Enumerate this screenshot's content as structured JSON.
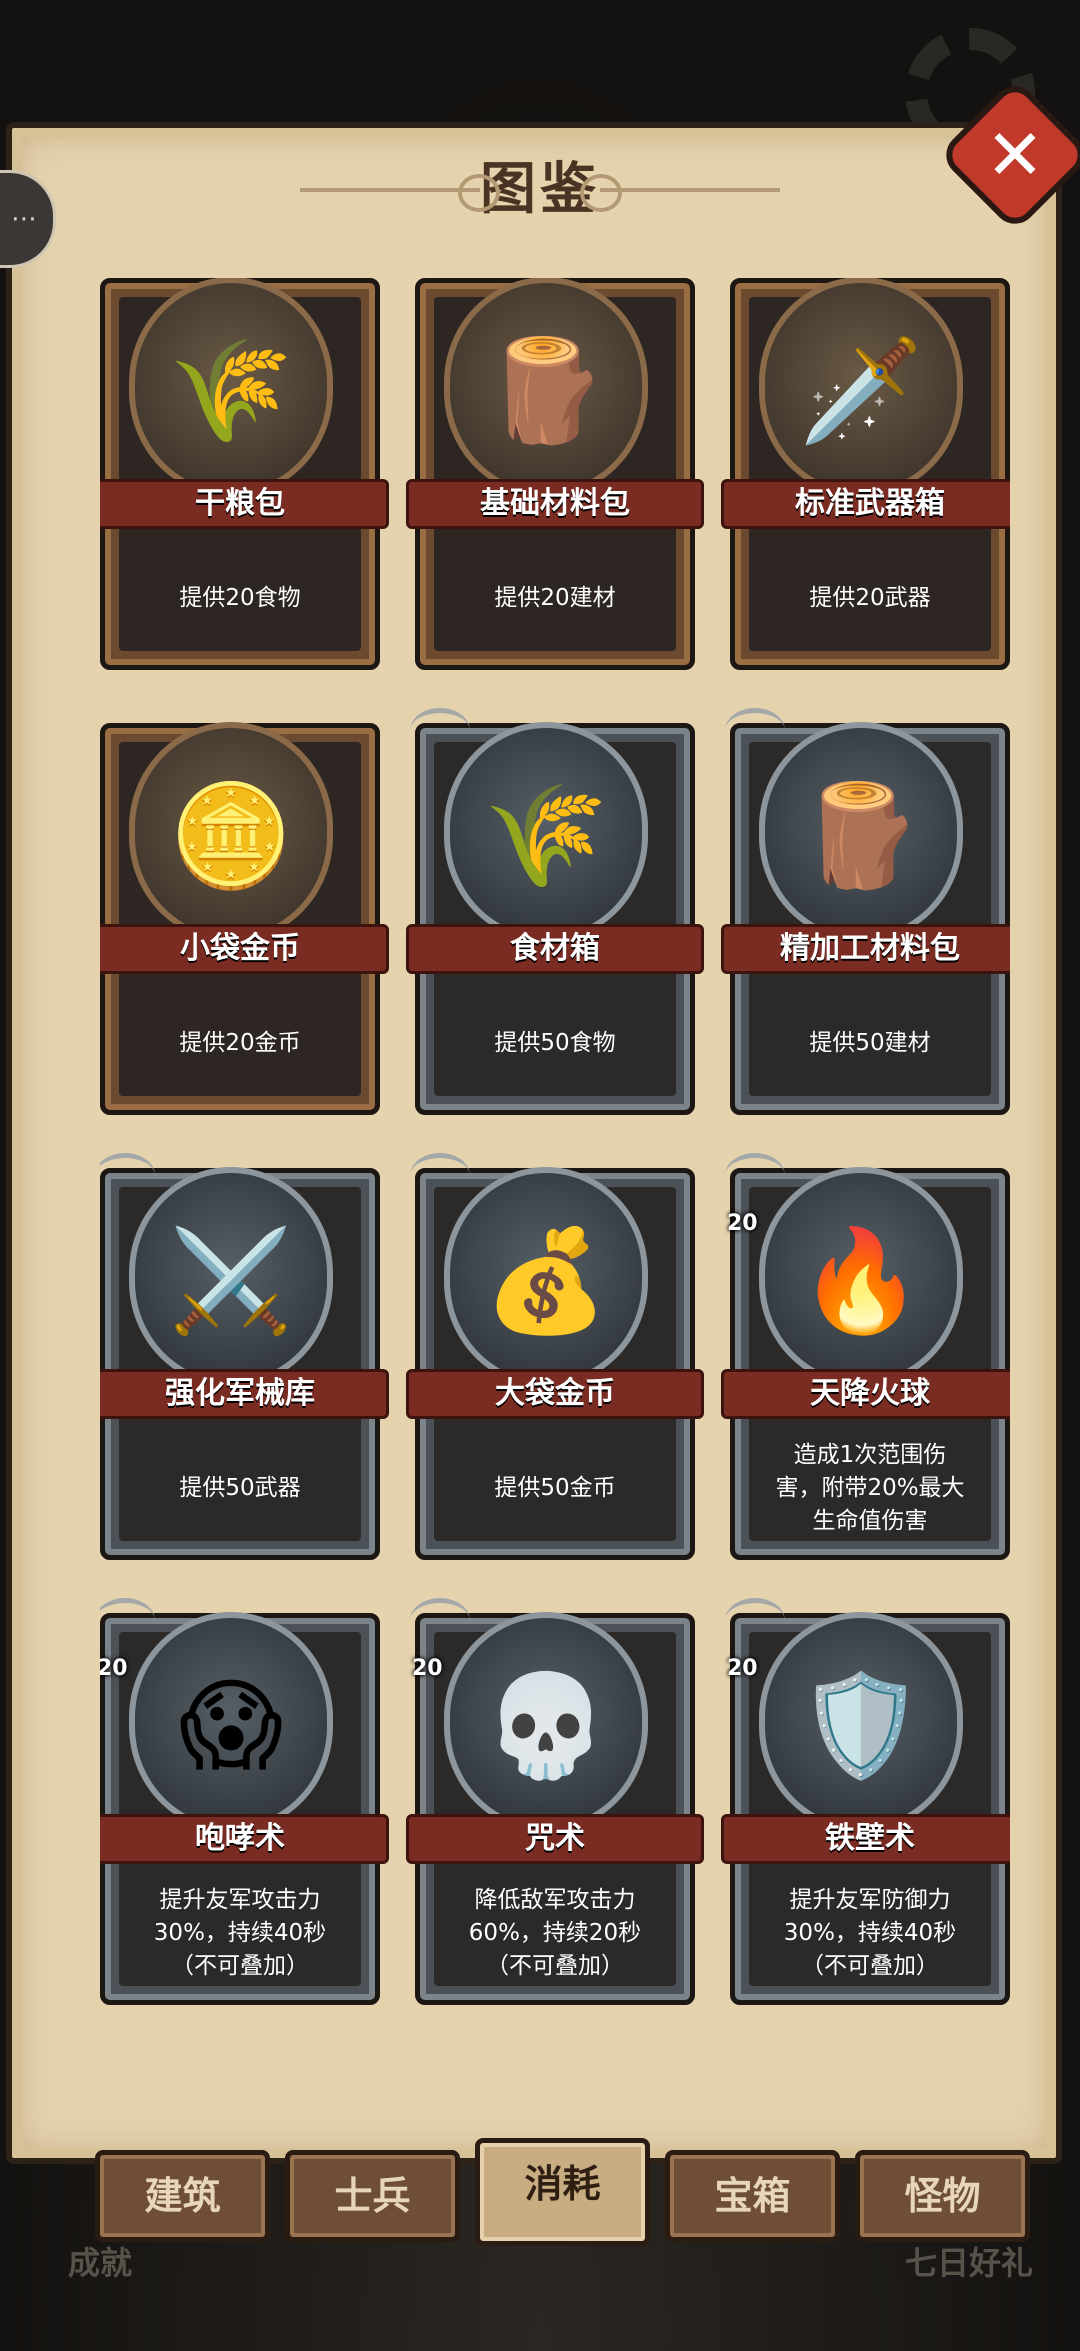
{
  "title": "图鉴",
  "side_button": "⋯",
  "close": "✕",
  "cards": [
    {
      "name": "干粮包",
      "desc": "提供20食物",
      "icon": "wheat-icon",
      "glyph": "🌾",
      "tier": "brown"
    },
    {
      "name": "基础材料包",
      "desc": "提供20建材",
      "icon": "log-icon",
      "glyph": "🪵",
      "tier": "brown"
    },
    {
      "name": "标准武器箱",
      "desc": "提供20武器",
      "icon": "sword-shield-icon",
      "glyph": "🗡️",
      "tier": "brown"
    },
    {
      "name": "小袋金币",
      "desc": "提供20金币",
      "icon": "coins-icon",
      "glyph": "🪙",
      "tier": "brown"
    },
    {
      "name": "食材箱",
      "desc": "提供50食物",
      "icon": "grain-sack-icon",
      "glyph": "🌾",
      "tier": "gray"
    },
    {
      "name": "精加工材料包",
      "desc": "提供50建材",
      "icon": "bundled-logs-icon",
      "glyph": "🪵",
      "tier": "gray"
    },
    {
      "name": "强化军械库",
      "desc": "提供50武器",
      "icon": "armor-sword-icon",
      "glyph": "⚔️",
      "tier": "gray"
    },
    {
      "name": "大袋金币",
      "desc": "提供50金币",
      "icon": "money-bag-icon",
      "glyph": "💰",
      "tier": "gray"
    },
    {
      "name": "天降火球",
      "desc": "造成1次范围伤\n害，附带20%最大\n生命值伤害",
      "icon": "fireball-icon",
      "glyph": "🔥",
      "tier": "gray",
      "level": "20"
    },
    {
      "name": "咆哮术",
      "desc": "提升友军攻击力\n30%，持续40秒\n（不可叠加）",
      "icon": "roar-icon",
      "glyph": "😱",
      "tier": "gray",
      "level": "20"
    },
    {
      "name": "咒术",
      "desc": "降低敌军攻击力\n60%，持续20秒\n（不可叠加）",
      "icon": "skull-icon",
      "glyph": "💀",
      "tier": "gray",
      "level": "20"
    },
    {
      "name": "铁壁术",
      "desc": "提升友军防御力\n30%，持续40秒\n（不可叠加）",
      "icon": "shield-icon",
      "glyph": "🛡️",
      "tier": "gray",
      "level": "20"
    }
  ],
  "tabs": [
    {
      "label": "建筑",
      "active": false
    },
    {
      "label": "士兵",
      "active": false
    },
    {
      "label": "消耗",
      "active": true
    },
    {
      "label": "宝箱",
      "active": false
    },
    {
      "label": "怪物",
      "active": false
    }
  ],
  "bottom": {
    "left": "成就",
    "right": "七日好礼"
  },
  "colors": {
    "panel": "#e5d3ae",
    "close": "#c0392b",
    "banner": "#7a2b22"
  }
}
